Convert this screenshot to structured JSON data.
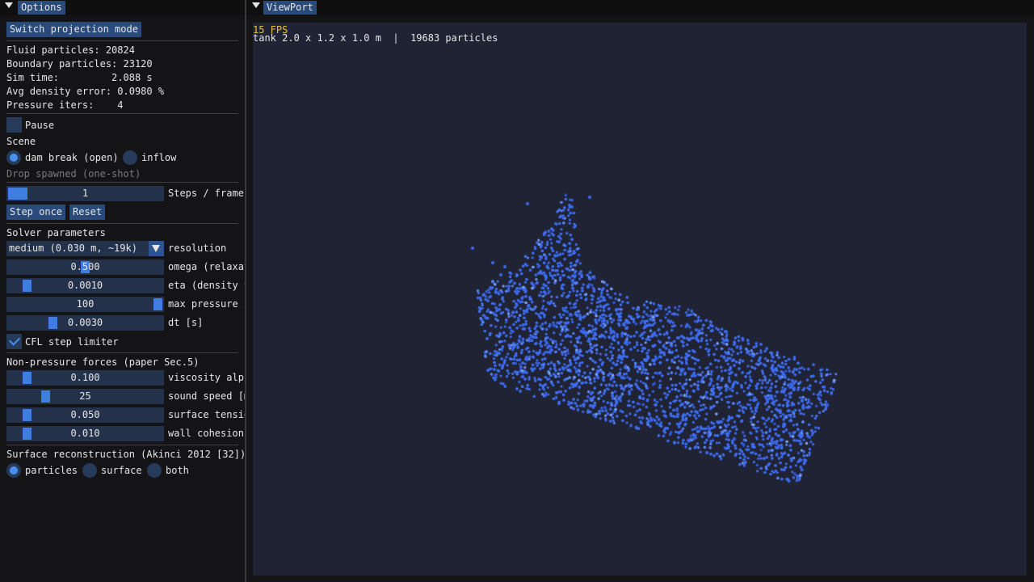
{
  "options_window": {
    "title": "Options",
    "switch_projection_label": "Switch projection mode",
    "stats": [
      {
        "label": "Fluid particles:  20824"
      },
      {
        "label": "Boundary particles: 23120"
      },
      {
        "label": "Sim time:         2.088 s"
      },
      {
        "label": "Avg density error: 0.0980 %"
      },
      {
        "label": "Pressure iters:    4"
      }
    ],
    "pause_label": "Pause",
    "pause_checked": false,
    "scene_header": "Scene",
    "scene_options": [
      {
        "label": "dam break (open)",
        "selected": true
      },
      {
        "label": "inflow",
        "selected": false
      }
    ],
    "drop_spawned_label": "Drop spawned (one-shot)",
    "steps_per_frame": {
      "value": "1",
      "label": "Steps / frame",
      "fraction": 0.0
    },
    "step_once_label": "Step once",
    "reset_label": "Reset",
    "solver_header": "Solver parameters",
    "resolution": {
      "value": "medium (0.030 m, ~19k)",
      "label": "resolution"
    },
    "solver_sliders": [
      {
        "value": "0.500",
        "label": "omega (relaxation)",
        "fraction": 0.5
      },
      {
        "value": "0.0010",
        "label": "eta (density tolerance)",
        "fraction": 0.1
      },
      {
        "value": "100",
        "label": "max pressure iters",
        "fraction": 1.0
      },
      {
        "value": "0.0030",
        "label": "dt [s]",
        "fraction": 0.28
      }
    ],
    "cfl_label": "CFL step limiter",
    "cfl_checked": true,
    "nonpressure_header": "Non-pressure forces (paper Sec.5)",
    "force_sliders": [
      {
        "value": "0.100",
        "label": "viscosity alpha",
        "fraction": 0.1
      },
      {
        "value": "25",
        "label": "sound speed [m/s]",
        "fraction": 0.23
      },
      {
        "value": "0.050",
        "label": "surface tension",
        "fraction": 0.1
      },
      {
        "value": "0.010",
        "label": "wall cohesion",
        "fraction": 0.1
      }
    ],
    "surface_header": "Surface reconstruction (Akinci 2012 [32])",
    "surface_options": [
      {
        "label": "particles",
        "selected": true
      },
      {
        "label": "surface",
        "selected": false
      },
      {
        "label": "both",
        "selected": false
      }
    ]
  },
  "viewport_window": {
    "title": "ViewPort",
    "fps_text": "15 FPS",
    "info_text": "tank 2.0 x 1.2 x 1.0 m  |  19683 particles"
  },
  "colors": {
    "accent": "#4a90f0",
    "particle": "#3f6cf0",
    "fps": "#e8c040",
    "viewport_bg": "#1f2334"
  }
}
